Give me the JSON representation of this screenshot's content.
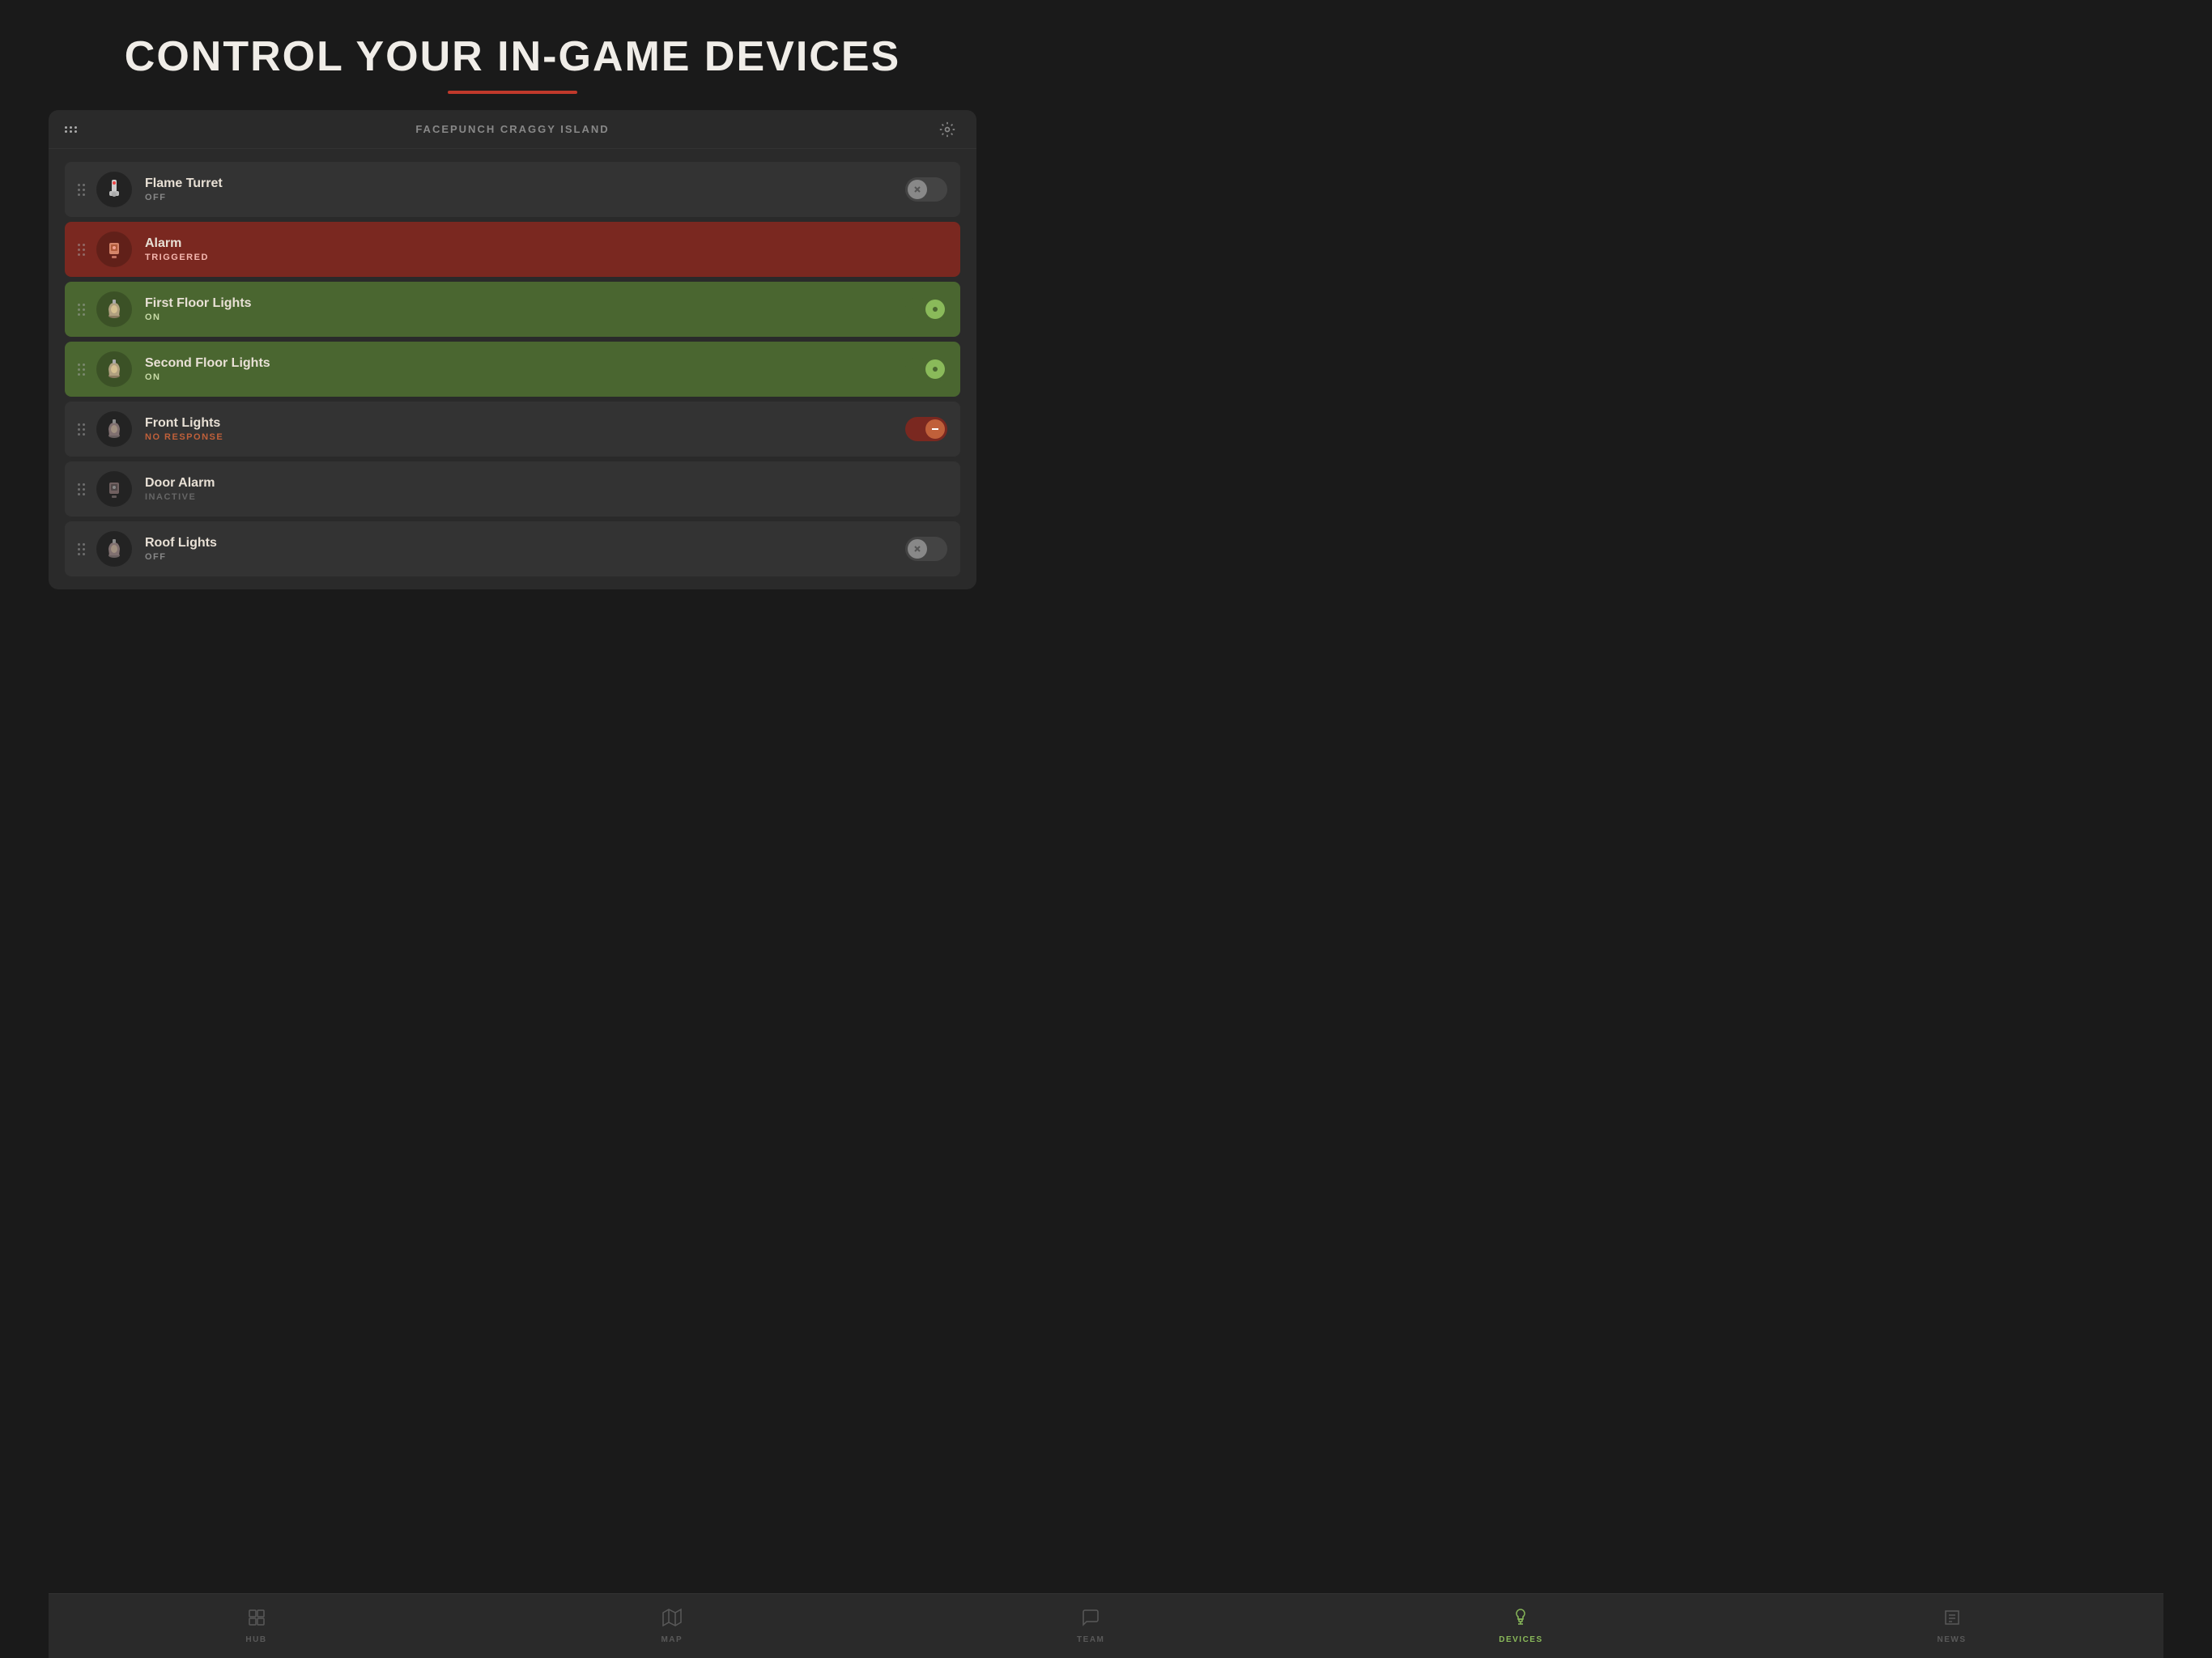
{
  "page": {
    "title": "CONTROL YOUR IN-GAME DEVICES",
    "title_underline_color": "#c0392b"
  },
  "header": {
    "server_name": "FACEPUNCH CRAGGY ISLAND",
    "settings_label": "⚙"
  },
  "devices": [
    {
      "id": "flame-turret",
      "name": "Flame Turret",
      "status": "OFF",
      "status_class": "status-off",
      "row_class": "off",
      "toggle_state": "off",
      "icon_type": "turret"
    },
    {
      "id": "alarm",
      "name": "Alarm",
      "status": "TRIGGERED",
      "status_class": "status-triggered",
      "row_class": "triggered",
      "toggle_state": "triggered",
      "icon_type": "alarm"
    },
    {
      "id": "first-floor-lights",
      "name": "First Floor Lights",
      "status": "ON",
      "status_class": "status-on",
      "row_class": "on",
      "toggle_state": "on",
      "icon_type": "light"
    },
    {
      "id": "second-floor-lights",
      "name": "Second Floor Lights",
      "status": "ON",
      "status_class": "status-on",
      "row_class": "on",
      "toggle_state": "on",
      "icon_type": "light"
    },
    {
      "id": "front-lights",
      "name": "Front Lights",
      "status": "NO RESPONSE",
      "status_class": "status-no-response",
      "row_class": "no-response",
      "toggle_state": "error",
      "icon_type": "light"
    },
    {
      "id": "door-alarm",
      "name": "Door Alarm",
      "status": "INACTIVE",
      "status_class": "status-inactive",
      "row_class": "inactive",
      "toggle_state": "off",
      "icon_type": "alarm-small"
    },
    {
      "id": "roof-lights",
      "name": "Roof Lights",
      "status": "OFF",
      "status_class": "status-off",
      "row_class": "off",
      "toggle_state": "off",
      "icon_type": "light"
    }
  ],
  "nav": {
    "items": [
      {
        "id": "hub",
        "label": "HUB",
        "active": false,
        "icon": "grid"
      },
      {
        "id": "map",
        "label": "MAP",
        "active": false,
        "icon": "map"
      },
      {
        "id": "team",
        "label": "TEAM",
        "active": false,
        "icon": "chat"
      },
      {
        "id": "devices",
        "label": "DEVICES",
        "active": true,
        "icon": "bulb"
      },
      {
        "id": "news",
        "label": "NEWS",
        "active": false,
        "icon": "news"
      }
    ]
  }
}
